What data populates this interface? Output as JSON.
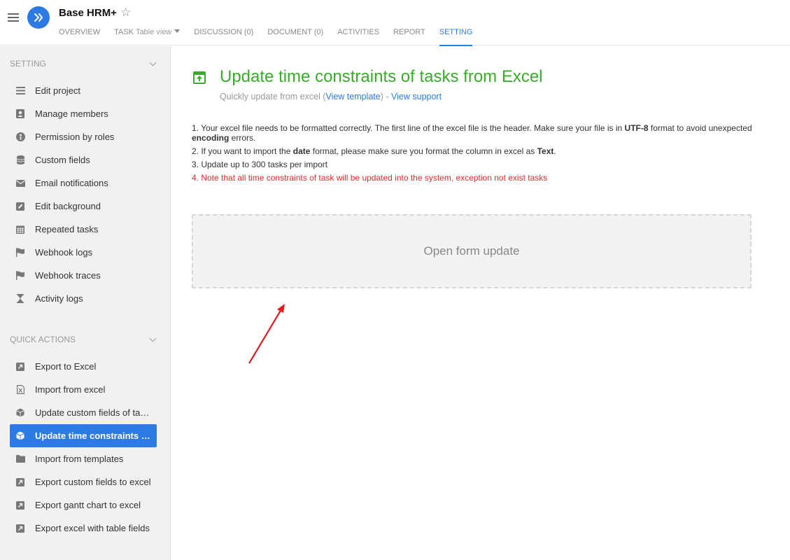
{
  "header": {
    "project_title": "Base HRM+",
    "tabs": [
      {
        "label": "OVERVIEW"
      },
      {
        "label": "TASK",
        "sub": "Table view"
      },
      {
        "label": "DISCUSSION (0)"
      },
      {
        "label": "DOCUMENT (0)"
      },
      {
        "label": "ACTIVITIES"
      },
      {
        "label": "REPORT"
      },
      {
        "label": "SETTING"
      }
    ]
  },
  "sidebar": {
    "setting_title": "SETTING",
    "setting_items": [
      {
        "label": "Edit project",
        "icon": "list-icon"
      },
      {
        "label": "Manage members",
        "icon": "members-icon"
      },
      {
        "label": "Permission by roles",
        "icon": "permission-icon"
      },
      {
        "label": "Custom fields",
        "icon": "database-icon"
      },
      {
        "label": "Email notifications",
        "icon": "envelope-icon"
      },
      {
        "label": "Edit background",
        "icon": "edit-icon"
      },
      {
        "label": "Repeated tasks",
        "icon": "calendar-icon"
      },
      {
        "label": "Webhook logs",
        "icon": "flag-icon"
      },
      {
        "label": "Webhook traces",
        "icon": "flag-icon"
      },
      {
        "label": "Activity logs",
        "icon": "hourglass-icon"
      }
    ],
    "quick_title": "QUICK ACTIONS",
    "quick_items": [
      {
        "label": "Export to Excel",
        "icon": "external-link-icon"
      },
      {
        "label": "Import from excel",
        "icon": "excel-file-icon"
      },
      {
        "label": "Update custom fields of tasks",
        "icon": "cube-icon"
      },
      {
        "label": "Update time constraints of tasks",
        "icon": "cube-icon"
      },
      {
        "label": "Import from templates",
        "icon": "folder-icon"
      },
      {
        "label": "Export custom fields to excel",
        "icon": "external-link-icon"
      },
      {
        "label": "Export gantt chart to excel",
        "icon": "external-link-icon"
      },
      {
        "label": "Export excel with table fields",
        "icon": "external-link-icon"
      }
    ]
  },
  "main": {
    "title": "Update time constraints of tasks from Excel",
    "subtitle_prefix": "Quickly update from excel (",
    "view_template": "View template",
    "subtitle_mid": ") - ",
    "view_support": "View support",
    "notes": {
      "n1_a": "1. Your excel file needs to be formatted correctly. The first line of the excel file is the header. Make sure your file is in ",
      "n1_b": "UTF-8",
      "n1_c": " format to avoid unexpected ",
      "n1_d": "encoding",
      "n1_e": " errors.",
      "n2_a": "2. If you want to import the ",
      "n2_b": "date",
      "n2_c": " format, please make sure you format the column in excel as ",
      "n2_d": "Text",
      "n2_e": ".",
      "n3": "3. Update up to 300 tasks per import",
      "n4": "4. Note that all time constraints of task will be updated into the system, exception not exist tasks"
    },
    "dropzone_label": "Open form update"
  },
  "colors": {
    "accent": "#2c7be5",
    "title_green": "#3aab2a",
    "warning_red": "#e52b2b",
    "annotation_arrow": "#e8191c"
  }
}
